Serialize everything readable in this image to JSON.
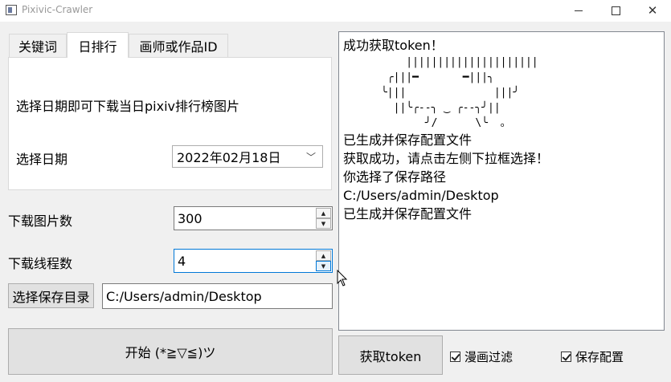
{
  "window": {
    "title": "Pixivic-Crawler"
  },
  "tabs": [
    {
      "label": "关键词"
    },
    {
      "label": "日排行"
    },
    {
      "label": "画师或作品ID"
    }
  ],
  "daily_panel": {
    "description": "选择日期即可下载当日pixiv排行榜图片",
    "date_label": "选择日期",
    "date_value": "2022年02月18日"
  },
  "download": {
    "count_label": "下载图片数",
    "count_value": "300",
    "threads_label": "下载线程数",
    "threads_value": "4"
  },
  "save_dir": {
    "button_label": "选择保存目录",
    "path_value": "C:/Users/admin/Desktop"
  },
  "start_button": {
    "label": "开始  (*≧▽≦)ツ"
  },
  "log": {
    "line_success": "成功获取token！",
    "art": "          |||||||||||||||||||||\n       ╭|||━       ━|||╮\n      ╰|||              |||╯\n        ||╰╭--╮ ‿ ╭--╮╯||\n             ╯/      \\╰  。",
    "lines": [
      "已生成并保存配置文件",
      "获取成功，请点击左侧下拉框选择！",
      "你选择了保存路径",
      "C:/Users/admin/Desktop",
      "已生成并保存配置文件"
    ]
  },
  "token_button": {
    "label": "获取token"
  },
  "options": {
    "manga_filter": {
      "label": "漫画过滤",
      "checked": true
    },
    "save_config": {
      "label": "保存配置",
      "checked": true
    }
  }
}
